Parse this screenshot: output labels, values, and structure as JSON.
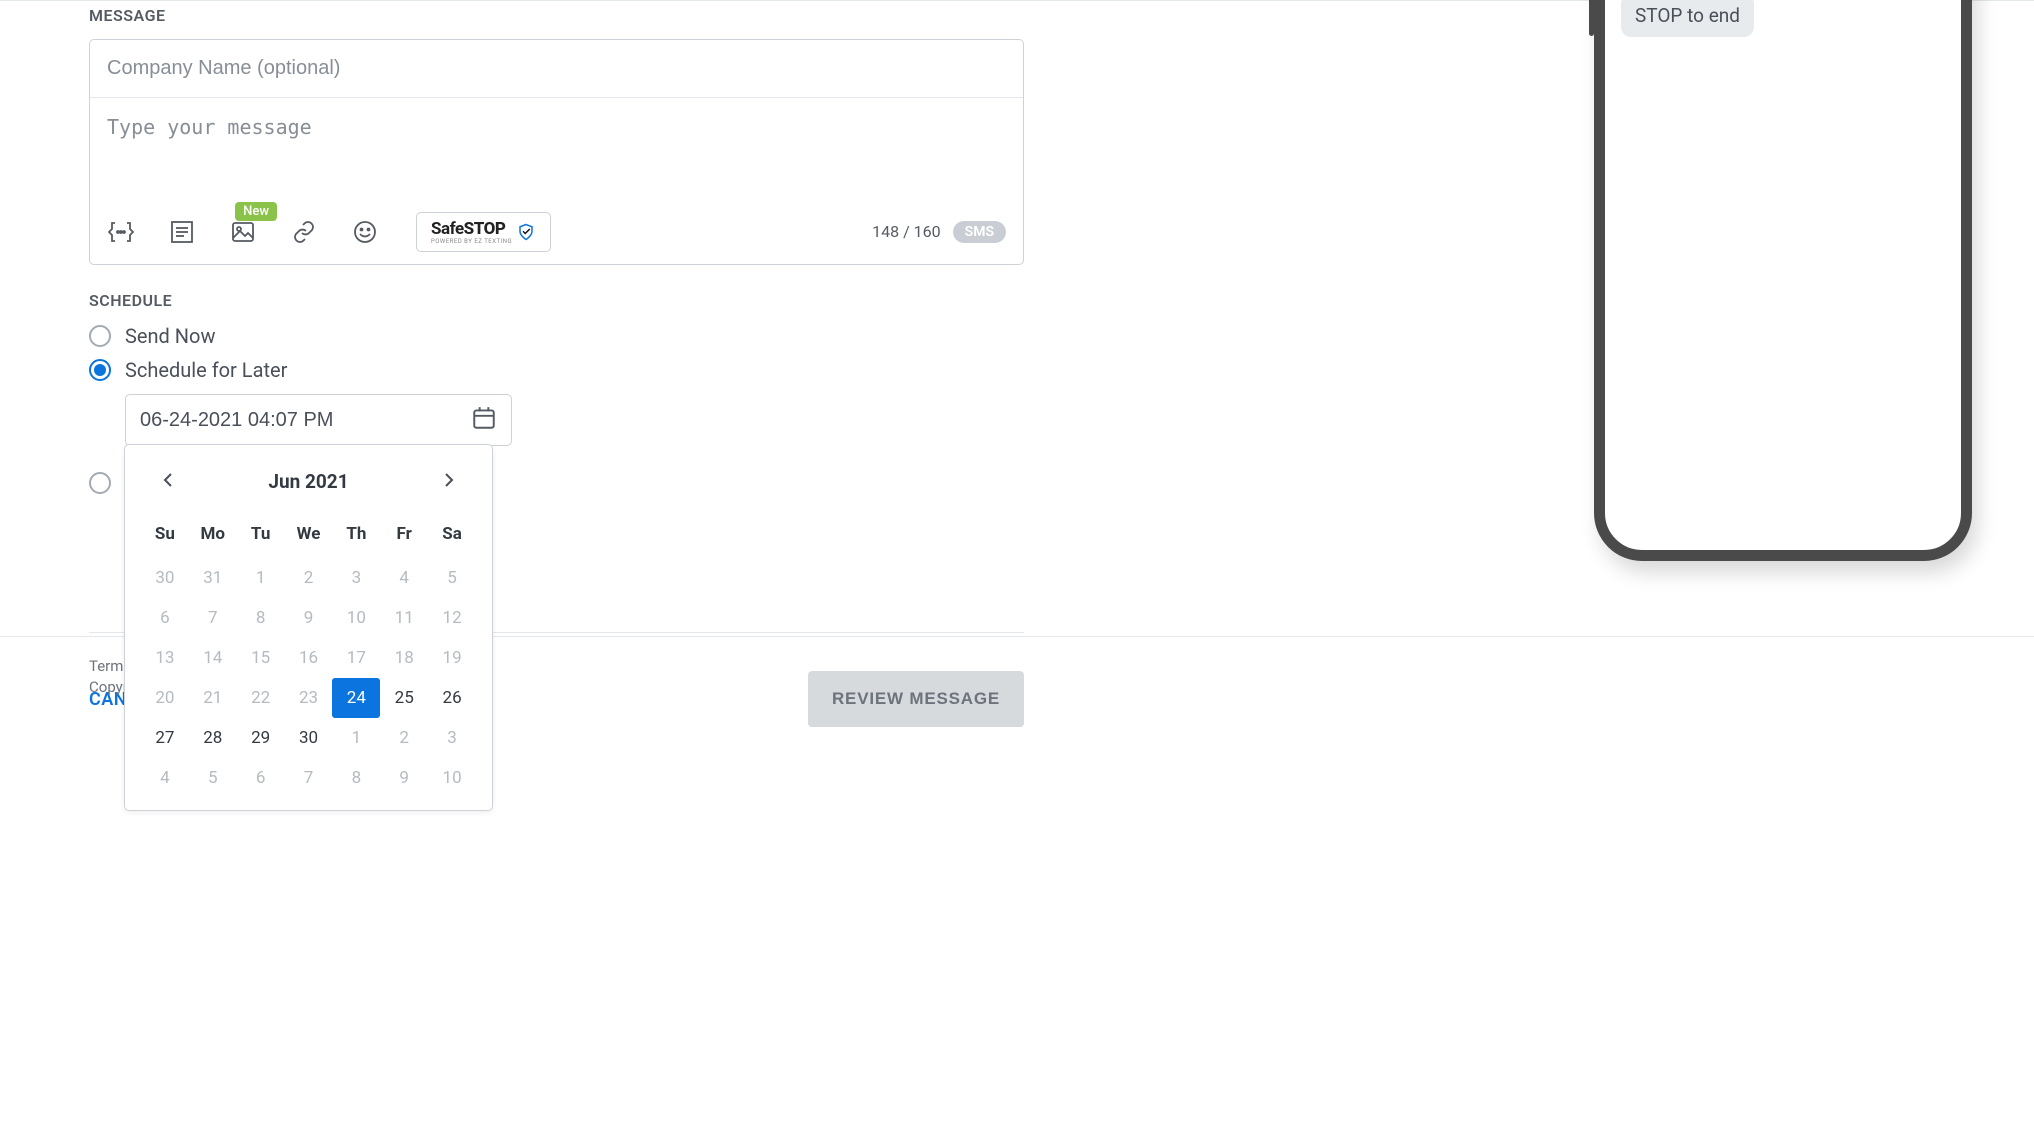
{
  "labels": {
    "message": "MESSAGE",
    "schedule": "SCHEDULE"
  },
  "message": {
    "company_placeholder": "Company Name (optional)",
    "body_placeholder": "Type your message",
    "toolbar": {
      "new_badge": "New",
      "safestop_brand1": "Safe",
      "safestop_brand2": "STOP",
      "safestop_powered": "POWERED BY EZ TEXTING"
    },
    "char_count": "148 / 160",
    "sms_pill": "SMS"
  },
  "schedule": {
    "send_now": "Send Now",
    "later": "Schedule for Later",
    "selected": "later",
    "date_value": "06-24-2021 04:07 PM"
  },
  "calendar": {
    "title": "Jun 2021",
    "dow": [
      "Su",
      "Mo",
      "Tu",
      "We",
      "Th",
      "Fr",
      "Sa"
    ],
    "rows": [
      [
        {
          "d": "30",
          "cls": "prev"
        },
        {
          "d": "31",
          "cls": "prev"
        },
        {
          "d": "1",
          "cls": "cur past"
        },
        {
          "d": "2",
          "cls": "cur past"
        },
        {
          "d": "3",
          "cls": "cur past"
        },
        {
          "d": "4",
          "cls": "cur past"
        },
        {
          "d": "5",
          "cls": "cur past"
        }
      ],
      [
        {
          "d": "6",
          "cls": "cur past"
        },
        {
          "d": "7",
          "cls": "cur past"
        },
        {
          "d": "8",
          "cls": "cur past"
        },
        {
          "d": "9",
          "cls": "cur past"
        },
        {
          "d": "10",
          "cls": "cur past"
        },
        {
          "d": "11",
          "cls": "cur past"
        },
        {
          "d": "12",
          "cls": "cur past"
        }
      ],
      [
        {
          "d": "13",
          "cls": "cur past"
        },
        {
          "d": "14",
          "cls": "cur past"
        },
        {
          "d": "15",
          "cls": "cur past"
        },
        {
          "d": "16",
          "cls": "cur past"
        },
        {
          "d": "17",
          "cls": "cur past"
        },
        {
          "d": "18",
          "cls": "cur past"
        },
        {
          "d": "19",
          "cls": "cur past"
        }
      ],
      [
        {
          "d": "20",
          "cls": "cur past"
        },
        {
          "d": "21",
          "cls": "cur past"
        },
        {
          "d": "22",
          "cls": "cur past"
        },
        {
          "d": "23",
          "cls": "cur past"
        },
        {
          "d": "24",
          "cls": "cur selected"
        },
        {
          "d": "25",
          "cls": "cur future"
        },
        {
          "d": "26",
          "cls": "cur future"
        }
      ],
      [
        {
          "d": "27",
          "cls": "cur future"
        },
        {
          "d": "28",
          "cls": "cur future"
        },
        {
          "d": "29",
          "cls": "cur future"
        },
        {
          "d": "30",
          "cls": "cur future"
        },
        {
          "d": "1",
          "cls": "next"
        },
        {
          "d": "2",
          "cls": "next"
        },
        {
          "d": "3",
          "cls": "next"
        }
      ],
      [
        {
          "d": "4",
          "cls": "next"
        },
        {
          "d": "5",
          "cls": "next"
        },
        {
          "d": "6",
          "cls": "next"
        },
        {
          "d": "7",
          "cls": "next"
        },
        {
          "d": "8",
          "cls": "next"
        },
        {
          "d": "9",
          "cls": "next"
        },
        {
          "d": "10",
          "cls": "next"
        }
      ]
    ]
  },
  "actions": {
    "cancel": "CANCEL",
    "review": "REVIEW MESSAGE"
  },
  "footer": {
    "terms": "Terms",
    "copyright": "Copyr"
  },
  "phone": {
    "preview_text": "STOP to end"
  }
}
